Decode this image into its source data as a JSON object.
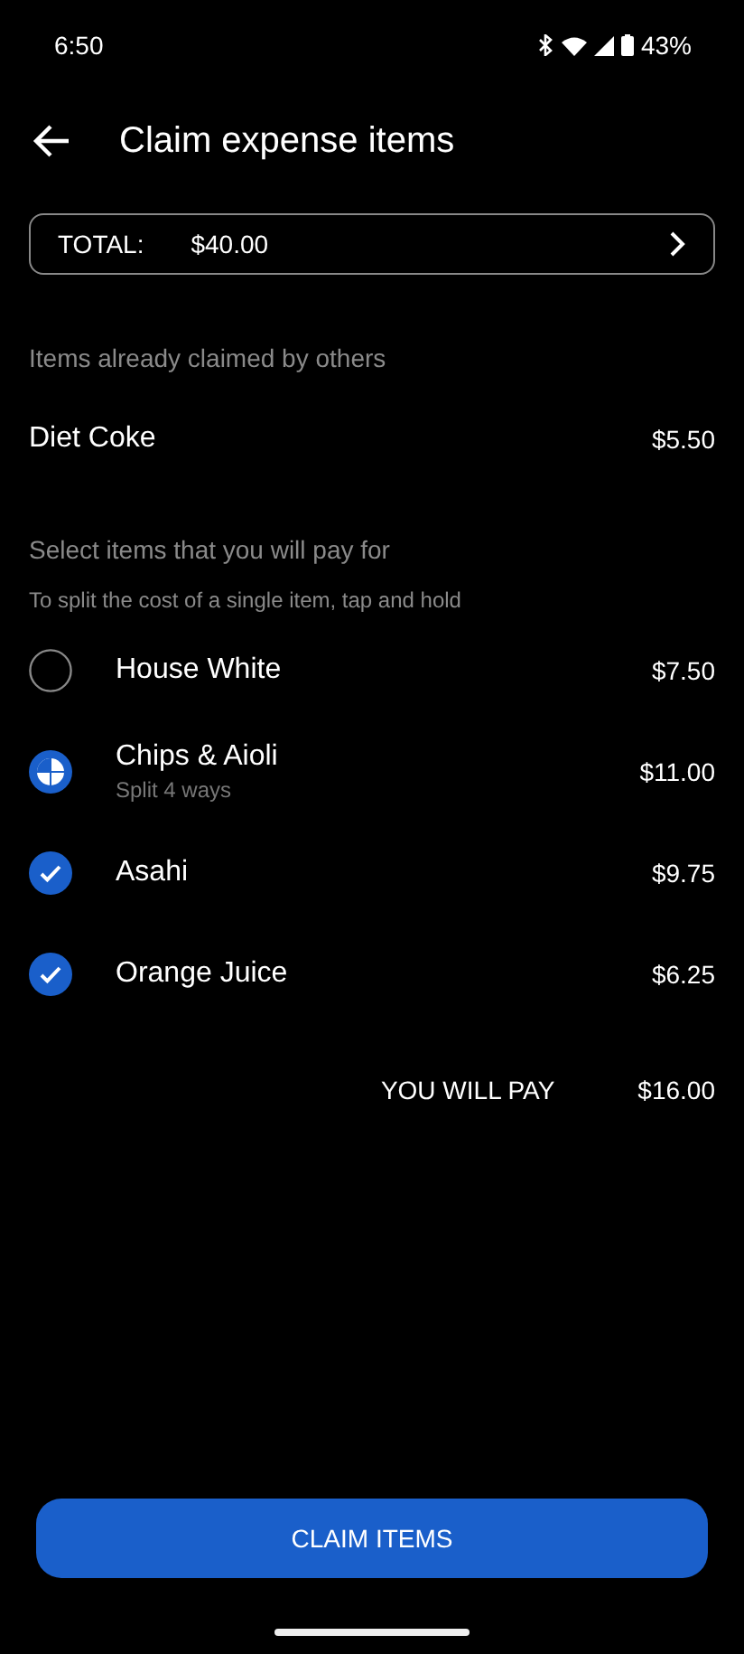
{
  "status_bar": {
    "time": "6:50",
    "battery": "43%"
  },
  "header": {
    "title": "Claim expense items"
  },
  "total": {
    "label": "TOTAL:",
    "amount": "$40.00"
  },
  "claimed_section": {
    "heading": "Items already claimed by others",
    "items": [
      {
        "name": "Diet Coke",
        "price": "$5.50"
      }
    ]
  },
  "select_section": {
    "heading": "Select items that you will pay for",
    "hint": "To split the cost of a single item, tap and hold",
    "items": [
      {
        "name": "House White",
        "price": "$7.50",
        "checked": false,
        "split": false
      },
      {
        "name": "Chips & Aioli",
        "note": "Split 4 ways",
        "price": "$11.00",
        "split": true
      },
      {
        "name": "Asahi",
        "price": "$9.75",
        "checked": true,
        "split": false
      },
      {
        "name": "Orange Juice",
        "price": "$6.25",
        "checked": true,
        "split": false
      }
    ]
  },
  "summary": {
    "label": "YOU WILL PAY",
    "amount": "$16.00"
  },
  "button": "CLAIM ITEMS"
}
